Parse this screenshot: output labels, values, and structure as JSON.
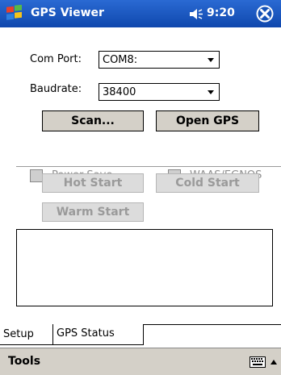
{
  "titlebar": {
    "title": "GPS Viewer",
    "time": "9:20"
  },
  "form": {
    "com_port_label": "Com Port:",
    "com_port_value": "COM8:",
    "baudrate_label": "Baudrate:",
    "baudrate_value": "38400",
    "scan_label": "Scan...",
    "open_gps_label": "Open GPS"
  },
  "options": {
    "power_save_label": "Power Save",
    "waas_label": "WAAS/EGNOS",
    "hot_start_label": "Hot Start",
    "cold_start_label": "Cold Start",
    "warm_start_label": "Warm Start"
  },
  "tabs": [
    {
      "label": "Setup"
    },
    {
      "label": "GPS Status"
    }
  ],
  "menubar": {
    "tools_label": "Tools"
  },
  "colors": {
    "titlebar": "#1552b6",
    "menubar": "#d4d0c8",
    "disabled_text": "#9a9a9a"
  }
}
